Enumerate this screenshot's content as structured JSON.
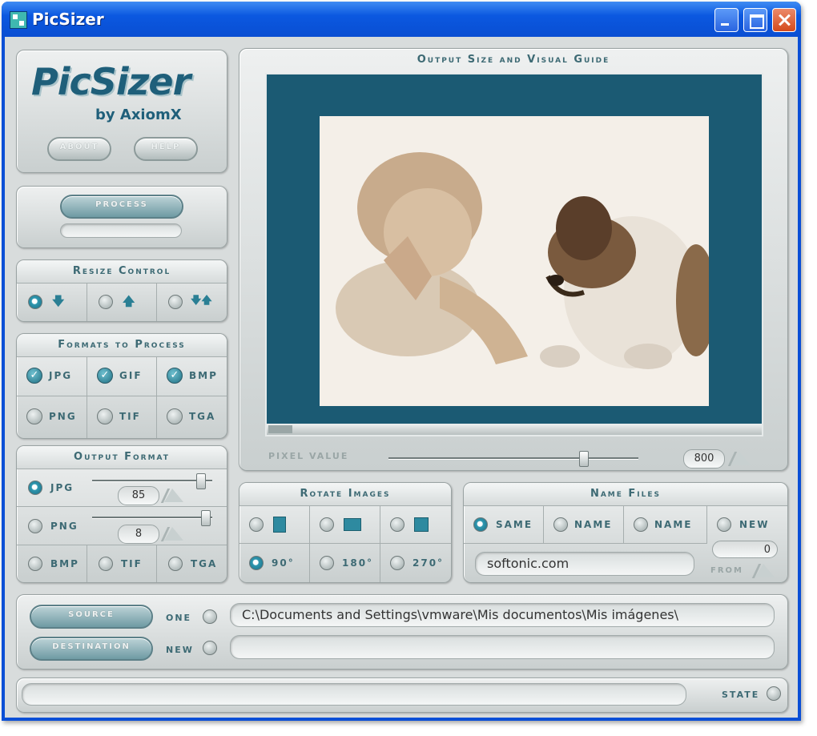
{
  "window": {
    "title": "PicSizer"
  },
  "logo": {
    "name": "PicSizer",
    "by": "by AxiomX",
    "about_label": "ABOUT",
    "help_label": "HELP"
  },
  "process": {
    "label": "PROCESS"
  },
  "resize_control": {
    "title": "Resize Control",
    "options": [
      "shrink-icon",
      "enlarge-icon",
      "both-icon"
    ],
    "selected": 0
  },
  "formats_to_process": {
    "title": "Formats to Process",
    "items": [
      {
        "label": "JPG",
        "checked": true
      },
      {
        "label": "GIF",
        "checked": true
      },
      {
        "label": "BMP",
        "checked": true
      },
      {
        "label": "PNG",
        "checked": false
      },
      {
        "label": "TIF",
        "checked": false
      },
      {
        "label": "TGA",
        "checked": false
      }
    ]
  },
  "output_format": {
    "title": "Output Format",
    "jpg_label": "JPG",
    "jpg_value": "85",
    "jpg_level": 0.9,
    "png_label": "PNG",
    "png_value": "8",
    "png_level": 0.94,
    "bmp_label": "BMP",
    "tif_label": "TIF",
    "tga_label": "TGA",
    "selected": "JPG"
  },
  "preview": {
    "title": "Output Size and Visual Guide",
    "pixel_value_label": "PIXEL VALUE",
    "pixel_value": "800",
    "pixel_level": 0.78,
    "bg_color": "#1b5a73"
  },
  "rotate_images": {
    "title": "Rotate Images",
    "deg90": "90°",
    "deg180": "180°",
    "deg270": "270°",
    "selected": "90°"
  },
  "name_files": {
    "title": "Name Files",
    "same": "SAME",
    "name_a": "NAME",
    "name_b": "NAME",
    "new": "NEW",
    "name_value": "softonic.com",
    "counter_value": "0",
    "from_label": "FROM"
  },
  "paths": {
    "source_label": "SOURCE",
    "destination_label": "DESTINATION",
    "one_label": "ONE",
    "new_label": "NEW",
    "source_path": "C:\\Documents and Settings\\vmware\\Mis documentos\\Mis imágenes\\",
    "destination_path": ""
  },
  "status": {
    "state_label": "STATE"
  }
}
